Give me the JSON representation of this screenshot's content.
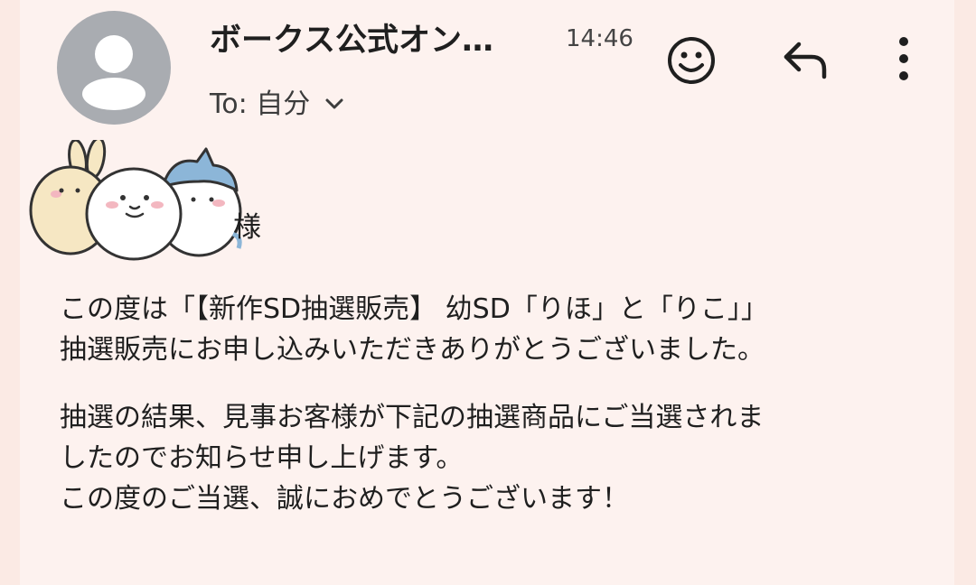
{
  "header": {
    "sender": "ボークス公式オン…",
    "time": "14:46",
    "to_label": "To: 自分",
    "icons": {
      "avatar": "person-icon",
      "expand": "chevron-down-icon",
      "emoji": "emoji-reaction-icon",
      "reply": "reply-icon",
      "more": "more-vert-icon"
    }
  },
  "greeting": {
    "sticker": "chiikawa-characters-sticker",
    "honorific": "様"
  },
  "body": {
    "paragraph1": [
      "この度は「【新作SD抽選販売】 幼SD「りほ」と「りこ」」",
      "抽選販売にお申し込みいただきありがとうございました。"
    ],
    "paragraph2": [
      "抽選の結果、見事お客様が下記の抽選商品にご当選されま",
      "したのでお知らせ申し上げます。",
      "この度のご当選、誠におめでとうございます！"
    ]
  },
  "colors": {
    "background": "#fdf2ef",
    "avatar": "#a9acb1"
  }
}
